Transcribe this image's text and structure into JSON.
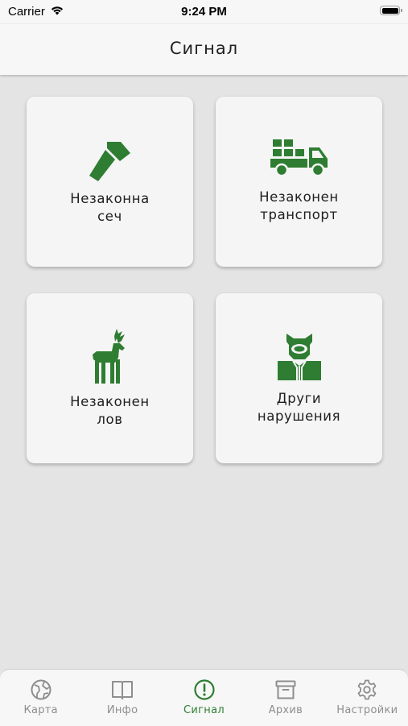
{
  "status_bar": {
    "carrier": "Carrier",
    "time": "9:24 PM",
    "icons": [
      "wifi-icon",
      "battery-icon"
    ]
  },
  "nav": {
    "title": "Сигнал"
  },
  "accent_color": "#2e7d32",
  "cards": [
    {
      "icon": "axe-icon",
      "line1": "Незаконна",
      "line2": "сеч"
    },
    {
      "icon": "truck-icon",
      "line1": "Незаконен",
      "line2": "транспорт"
    },
    {
      "icon": "deer-icon",
      "line1": "Незаконен",
      "line2": "лов"
    },
    {
      "icon": "boar-icon",
      "line1": "Други",
      "line2": "нарушения"
    }
  ],
  "tabs": [
    {
      "icon": "globe-icon",
      "label": "Карта",
      "active": false
    },
    {
      "icon": "book-icon",
      "label": "Инфо",
      "active": false
    },
    {
      "icon": "alert-circle-icon",
      "label": "Сигнал",
      "active": true
    },
    {
      "icon": "archive-icon",
      "label": "Архив",
      "active": false
    },
    {
      "icon": "gear-icon",
      "label": "Настройки",
      "active": false
    }
  ]
}
